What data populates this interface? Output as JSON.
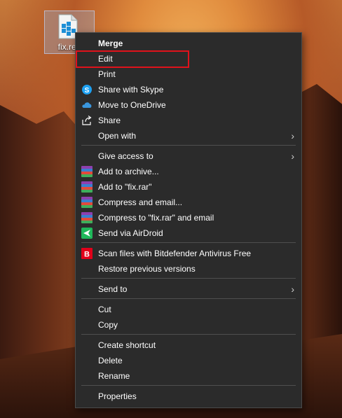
{
  "desktop": {
    "file_label": "fix.reg"
  },
  "menu": {
    "items": [
      {
        "label": "Merge",
        "icon": "",
        "bold": true
      },
      {
        "label": "Edit",
        "icon": ""
      },
      {
        "label": "Print",
        "icon": ""
      },
      {
        "label": "Share with Skype",
        "icon": "skype-icon"
      },
      {
        "label": "Move to OneDrive",
        "icon": "onedrive-icon"
      },
      {
        "label": "Share",
        "icon": "share-icon"
      },
      {
        "label": "Open with",
        "icon": "",
        "submenu": true
      },
      {
        "label": "Give access to",
        "icon": "",
        "submenu": true
      },
      {
        "label": "Add to archive...",
        "icon": "winrar-icon"
      },
      {
        "label": "Add to \"fix.rar\"",
        "icon": "winrar-icon"
      },
      {
        "label": "Compress and email...",
        "icon": "winrar-icon"
      },
      {
        "label": "Compress to \"fix.rar\" and email",
        "icon": "winrar-icon"
      },
      {
        "label": "Send via AirDroid",
        "icon": "airdroid-icon"
      },
      {
        "label": "Scan files with Bitdefender Antivirus Free",
        "icon": "bitdefender-icon"
      },
      {
        "label": "Restore previous versions",
        "icon": ""
      },
      {
        "label": "Send to",
        "icon": "",
        "submenu": true
      },
      {
        "label": "Cut",
        "icon": ""
      },
      {
        "label": "Copy",
        "icon": ""
      },
      {
        "label": "Create shortcut",
        "icon": ""
      },
      {
        "label": "Delete",
        "icon": ""
      },
      {
        "label": "Rename",
        "icon": ""
      },
      {
        "label": "Properties",
        "icon": ""
      }
    ],
    "highlighted_item": "Edit",
    "highlight_color": "#e0121b"
  }
}
